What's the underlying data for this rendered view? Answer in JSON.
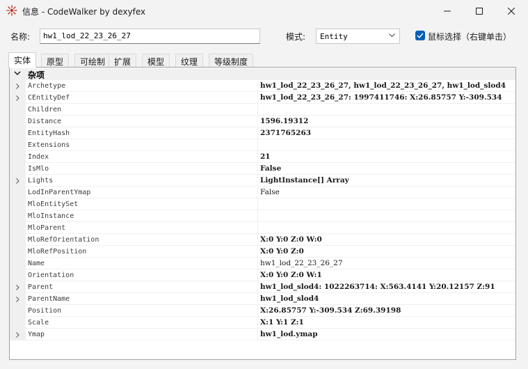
{
  "window": {
    "title": "信息 - CodeWalker by dexyfex"
  },
  "controls": {
    "name_label": "名称:",
    "name_value": "hw1_lod_22_23_26_27",
    "mode_label": "模式:",
    "mode_value": "Entity",
    "checkbox_label": "鼠标选择（右键单击）",
    "checkbox_checked": true
  },
  "tabs": [
    {
      "label": "实体",
      "active": true
    },
    {
      "label": "原型",
      "active": false
    },
    {
      "label": "可绘制",
      "active": false
    },
    {
      "label": "扩展",
      "active": false
    },
    {
      "label": "模型",
      "active": false
    },
    {
      "label": "纹理",
      "active": false
    },
    {
      "label": "等级制度",
      "active": false
    }
  ],
  "grid": {
    "category": "杂项",
    "rows": [
      {
        "name": "Archetype",
        "value": "hw1_lod_22_23_26_27, hw1_lod_22_23_26_27, hw1_lod_slod4",
        "expandable": true,
        "bold": true
      },
      {
        "name": "CEntityDef",
        "value": "hw1_lod_22_23_26_27: 1997411746: X:26.85757 Y:-309.534",
        "expandable": true,
        "bold": true
      },
      {
        "name": "Children",
        "value": "",
        "expandable": false,
        "bold": false
      },
      {
        "name": "Distance",
        "value": "1596.19312",
        "expandable": false,
        "bold": true
      },
      {
        "name": "EntityHash",
        "value": "2371765263",
        "expandable": false,
        "bold": true
      },
      {
        "name": "Extensions",
        "value": "",
        "expandable": false,
        "bold": false
      },
      {
        "name": "Index",
        "value": "21",
        "expandable": false,
        "bold": true
      },
      {
        "name": "IsMlo",
        "value": "False",
        "expandable": false,
        "bold": true
      },
      {
        "name": "Lights",
        "value": "LightInstance[] Array",
        "expandable": true,
        "bold": true
      },
      {
        "name": "LodInParentYmap",
        "value": "False",
        "expandable": false,
        "bold": false
      },
      {
        "name": "MloEntitySet",
        "value": "",
        "expandable": false,
        "bold": false
      },
      {
        "name": "MloInstance",
        "value": "",
        "expandable": false,
        "bold": false
      },
      {
        "name": "MloParent",
        "value": "",
        "expandable": false,
        "bold": false
      },
      {
        "name": "MloRefOrientation",
        "value": "X:0 Y:0 Z:0 W:0",
        "expandable": false,
        "bold": true
      },
      {
        "name": "MloRefPosition",
        "value": "X:0 Y:0 Z:0",
        "expandable": false,
        "bold": true
      },
      {
        "name": "Name",
        "value": "hw1_lod_22_23_26_27",
        "expandable": false,
        "bold": false
      },
      {
        "name": "Orientation",
        "value": "X:0 Y:0 Z:0 W:1",
        "expandable": false,
        "bold": true
      },
      {
        "name": "Parent",
        "value": "hw1_lod_slod4: 1022263714: X:563.4141 Y:20.12157 Z:91",
        "expandable": true,
        "bold": true
      },
      {
        "name": "ParentName",
        "value": "hw1_lod_slod4",
        "expandable": true,
        "bold": true
      },
      {
        "name": "Position",
        "value": "X:26.85757 Y:-309.534 Z:69.39198",
        "expandable": false,
        "bold": true
      },
      {
        "name": "Scale",
        "value": "X:1 Y:1 Z:1",
        "expandable": false,
        "bold": true
      },
      {
        "name": "Ymap",
        "value": "hw1_lod.ymap",
        "expandable": true,
        "bold": true
      }
    ]
  },
  "colors": {
    "accent": "#005fb8",
    "app_icon": "#c42b1c"
  }
}
